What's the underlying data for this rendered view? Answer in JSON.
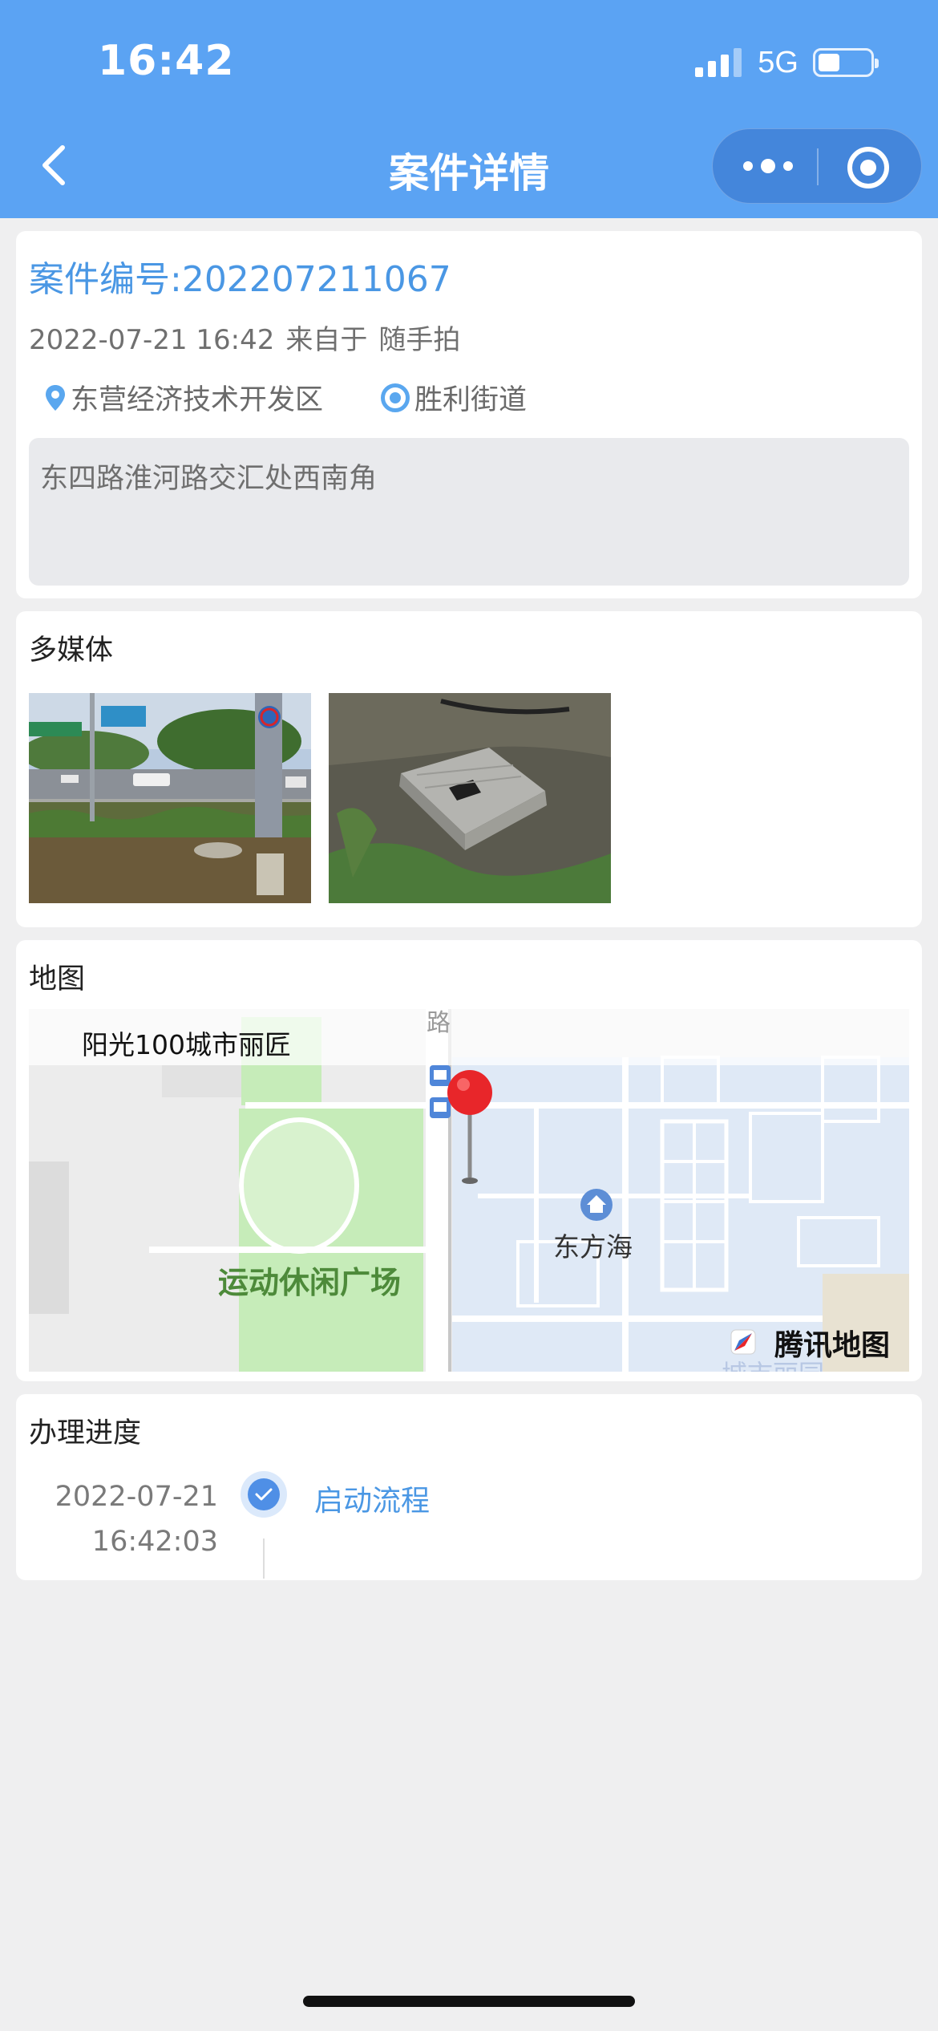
{
  "status_bar": {
    "time": "16:42",
    "network": "5G"
  },
  "nav": {
    "title": "案件详情",
    "accent_color": "#5ba3f3"
  },
  "case": {
    "number_label": "案件编号:202207211067",
    "datetime": "2022-07-21 16:42",
    "source_prefix": "来自于",
    "source": "随手拍",
    "district": "东营经济技术开发区",
    "street": "胜利街道",
    "address": "东四路淮河路交汇处西南角"
  },
  "media": {
    "title": "多媒体"
  },
  "map": {
    "title": "地图",
    "labels": {
      "community": "阳光100城市丽匠",
      "road": "路",
      "park": "运动休闲广场",
      "place": "东方海",
      "brand": "腾讯地图",
      "partial": "城市丽园"
    }
  },
  "progress": {
    "title": "办理进度",
    "steps": [
      {
        "date": "2022-07-21",
        "time": "16:42:03",
        "label": "启动流程"
      }
    ]
  }
}
